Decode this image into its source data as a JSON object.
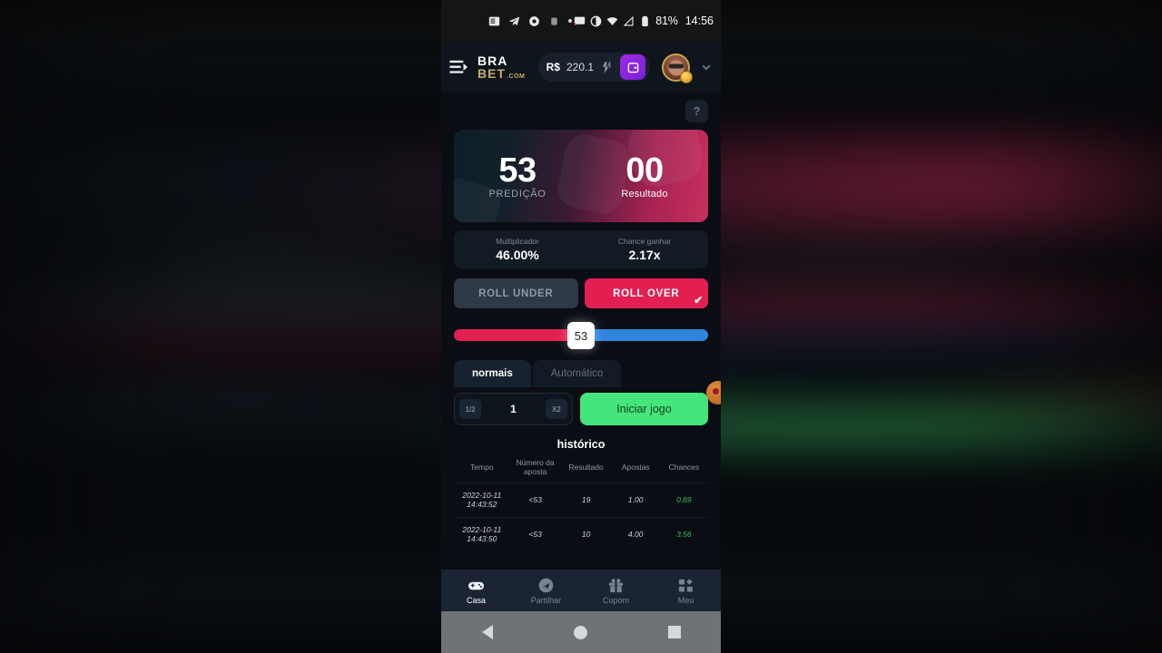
{
  "statusbar": {
    "icons": [
      "news-icon",
      "telegram-icon",
      "chrome-icon",
      "app-icon",
      "dot-icon",
      "cast-icon",
      "contrast-icon",
      "wifi-icon",
      "signal-icon",
      "battery-icon"
    ],
    "battery": "81%",
    "time": "14:56"
  },
  "header": {
    "menu_icon": "hamburger-menu-icon",
    "logo_top": "BRA",
    "logo_bottom": "BET",
    "logo_suffix": ".COM",
    "currency": "R$",
    "balance": "220.1",
    "flash_icon": "swap-icon",
    "wallet_icon": "wallet-icon",
    "avatar": "user-avatar",
    "chevron_icon": "chevron-down-icon"
  },
  "game": {
    "help_icon": "help-icon",
    "help_label": "?",
    "prediction_value": "53",
    "prediction_label": "PREDIÇÃO",
    "result_value": "00",
    "result_label": "Resultado",
    "stats": [
      {
        "label": "Multiplicador",
        "value": "46.00%"
      },
      {
        "label": "Chance ganhar",
        "value": "2.17x"
      }
    ],
    "roll_under_label": "ROLL UNDER",
    "roll_over_label": "ROLL OVER",
    "selected_roll": "ROLL OVER",
    "check_glyph": "✔",
    "slider_value": "53",
    "slider_min": 0,
    "slider_max": 100,
    "tabs": [
      {
        "label": "normais",
        "active": true
      },
      {
        "label": "Automático",
        "active": false
      }
    ],
    "bet": {
      "half_label": "1/2",
      "double_label": "X2",
      "amount": "1",
      "placeholder": "1"
    },
    "play_label": "Iniciar jogo",
    "accent_colors": {
      "roll_over": "#e31f52",
      "play_button": "#44e57c",
      "slider_left": "#e31f52",
      "slider_right": "#2f85de",
      "logo_gold": "#c9a96a",
      "win_green": "#2fbf5e"
    }
  },
  "history": {
    "title": "histórico",
    "columns": [
      "Tempo",
      "Número da aposta",
      "Resultado",
      "Apostas",
      "Chances"
    ],
    "rows": [
      {
        "date": "2022-10-11",
        "time": "14:43:52",
        "bet_number": "<53",
        "result": "19",
        "bets": "1.00",
        "chances": "0.89"
      },
      {
        "date": "2022-10-11",
        "time": "14:43:50",
        "bet_number": "<53",
        "result": "10",
        "bets": "4.00",
        "chances": "3.56"
      }
    ]
  },
  "bottomnav": {
    "items": [
      {
        "label": "Casa",
        "icon": "gamepad-icon",
        "active": true
      },
      {
        "label": "Partilhar",
        "icon": "share-icon",
        "active": false
      },
      {
        "label": "Cupom",
        "icon": "gift-icon",
        "active": false
      },
      {
        "label": "Meu",
        "icon": "grid-icon",
        "active": false
      }
    ]
  },
  "sysnav": {
    "back": "back-icon",
    "home": "home-icon",
    "recent": "recents-icon"
  }
}
